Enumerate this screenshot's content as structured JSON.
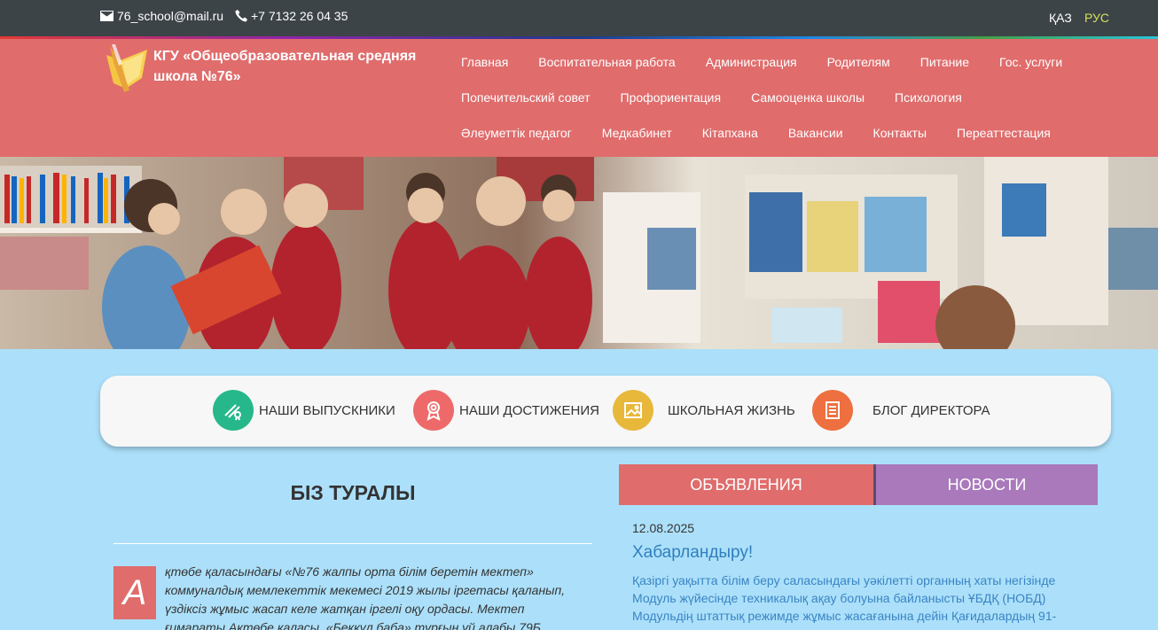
{
  "topbar": {
    "email": "76_school@mail.ru",
    "phone": "+7 7132 26 04 35",
    "lang_kaz": "ҚАЗ",
    "lang_rus": "РУС"
  },
  "header": {
    "school_name": "КГУ «Общеобразовательная средняя школа №76»",
    "nav_rows": [
      [
        "Главная",
        "Воспитательная работа",
        "Администрация",
        "Родителям",
        "Питание",
        "Гос. услуги"
      ],
      [
        "Попечительский совет",
        "Профориентация",
        "Самооценка школы",
        "Психология"
      ],
      [
        "Әлеуметтік педагог",
        "Медкабинет",
        "Кітапхана",
        "Вакансии",
        "Контакты",
        "Переаттестация"
      ]
    ]
  },
  "features": [
    {
      "label": "НАШИ ВЫПУСКНИКИ",
      "icon": "diploma-icon",
      "color": "#26b88a"
    },
    {
      "label": "НАШИ ДОСТИЖЕНИЯ",
      "icon": "award-icon",
      "color": "#ee6a6a"
    },
    {
      "label": "ШКОЛЬНАЯ ЖИЗНЬ",
      "icon": "image-icon",
      "color": "#e8b83b"
    },
    {
      "label": "БЛОГ ДИРЕКТОРА",
      "icon": "document-icon",
      "color": "#ee6f3f"
    }
  ],
  "about": {
    "title": "БІЗ ТУРАЛЫ",
    "dropcap": "А",
    "text": "қтөбе қаласындағы «№76 жалпы орта білім беретін мектеп» коммуналдық мемлекеттік мекемесі 2019 жылы іргетасы қаланып, үздіксіз жұмыс жасап келе жатқан  іргелі оқу ордасы. Мектеп ғимараты  Ақтөбе қаласы, «Беккұл баба» тұрғын үй алабы  79Б"
  },
  "news": {
    "tab_ads": "ОБЪЯВЛЕНИЯ",
    "tab_news": "НОВОСТИ",
    "date": "12.08.2025",
    "title": "Хабарландыру!",
    "body": "Қазіргі уақытта білім беру саласындағы уәкілетті органның хаты негізінде Модуль жүйесінде техникалық ақау болуына байланысты ҰБДҚ (НОБД) Модульдің штаттық режимде жұмыс жасағанына дейін Қағидалардың 91-"
  },
  "colors": {
    "topbar": "#3d4448",
    "header": "#e06c6c",
    "page_bg": "#ace0fa",
    "news_tab": "#a979bb",
    "link": "#2f7fbf"
  }
}
